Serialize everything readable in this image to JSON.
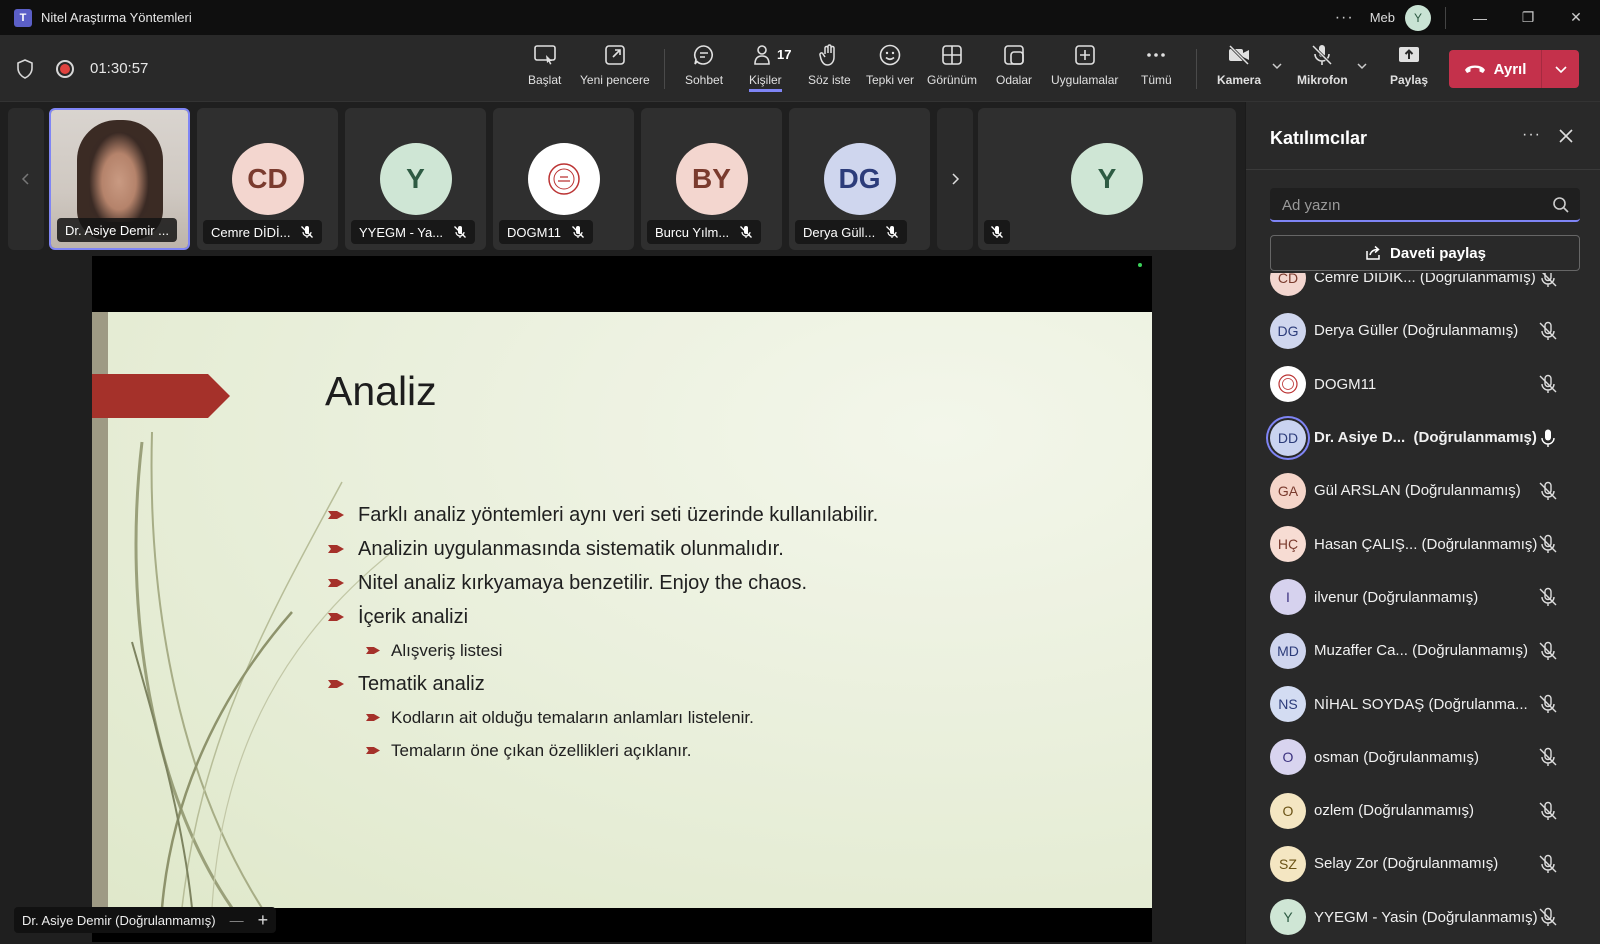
{
  "window": {
    "title": "Nitel Araştırma Yöntemleri",
    "logo_glyph": "T",
    "more": "···",
    "org": "Meb",
    "user_avatar": "Y",
    "min": "—",
    "restore": "❐",
    "close": "✕"
  },
  "meeting": {
    "timer": "01:30:57"
  },
  "toolbar": {
    "start": "Başlat",
    "new_window": "Yeni pencere",
    "chat": "Sohbet",
    "people": "Kişiler",
    "people_count": "17",
    "raise_hand": "Söz iste",
    "react": "Tepki ver",
    "view": "Görünüm",
    "rooms": "Odalar",
    "apps": "Uygulamalar",
    "more": "Tümü",
    "camera": "Kamera",
    "mic": "Mikrofon",
    "share": "Paylaş",
    "leave": "Ayrıl"
  },
  "tiles": [
    {
      "name": "Dr. Asiye Demir ..."
    },
    {
      "name": "Cemre DİDİ...",
      "initials": "CD"
    },
    {
      "name": "YYEGM - Ya...",
      "initials": "Y"
    },
    {
      "name": "DOGM11"
    },
    {
      "name": "Burcu Yılm...",
      "initials": "BY"
    },
    {
      "name": "Derya Güll...",
      "initials": "DG"
    },
    {
      "initials": "Y"
    }
  ],
  "slide": {
    "title": "Analiz",
    "bullets": [
      "Farklı analiz yöntemleri aynı veri seti üzerinde kullanılabilir.",
      "Analizin uygulanmasında sistematik olunmalıdır.",
      "Nitel analiz kırkyamaya benzetilir. Enjoy the chaos.",
      "İçerik analizi",
      "Alışveriş listesi",
      "Tematik analiz",
      "Kodların ait olduğu temaların anlamları listelenir.",
      "Temaların öne çıkan özellikleri açıklanır."
    ]
  },
  "speaker_label": "Dr. Asiye Demir (Doğrulanmamış)",
  "speaker_controls": {
    "minus": "—",
    "plus": "+"
  },
  "panel": {
    "title": "Katılımcılar",
    "more": "···",
    "search_placeholder": "Ad yazın",
    "share_invite": "Daveti paylaş",
    "participants": [
      {
        "initials": "CD",
        "name": "Cemre DİDİK... (Doğrulanmamış)",
        "color": "#f3d6cf",
        "fg": "#7a3b2e"
      },
      {
        "initials": "DG",
        "name": "Derya Güller (Doğrulanmamış)",
        "color": "#cfd6ee",
        "fg": "#2c3c7a"
      },
      {
        "initials": "",
        "name": "DOGM11",
        "color": "#ffffff",
        "fg": "#b33"
      },
      {
        "initials": "DD",
        "name": "Dr. Asiye D...",
        "suffix": "(Doğrulanmamış)",
        "color": "#c9d3f0",
        "fg": "#2c3c7a"
      },
      {
        "initials": "GA",
        "name": "Gül ARSLAN (Doğrulanmamış)",
        "color": "#f5d5c9",
        "fg": "#7a3b2e"
      },
      {
        "initials": "HÇ",
        "name": "Hasan ÇALIŞ... (Doğrulanmamış)",
        "color": "#f7dcd3",
        "fg": "#7a3b2e"
      },
      {
        "initials": "I",
        "name": "ilvenur (Doğrulanmamış)",
        "color": "#d6d2ee",
        "fg": "#3d3380"
      },
      {
        "initials": "MD",
        "name": "Muzaffer Ca... (Doğrulanmamış)",
        "color": "#cfd5ee",
        "fg": "#2c3c7a"
      },
      {
        "initials": "NS",
        "name": "NİHAL SOYDAŞ (Doğrulanma...",
        "color": "#d3dcf2",
        "fg": "#2c3c7a"
      },
      {
        "initials": "O",
        "name": "osman (Doğrulanmamış)",
        "color": "#d8d4ef",
        "fg": "#3d3380"
      },
      {
        "initials": "O",
        "name": "ozlem (Doğrulanmamış)",
        "color": "#f4e6c2",
        "fg": "#6b5316"
      },
      {
        "initials": "SZ",
        "name": "Selay Zor (Doğrulanmamış)",
        "color": "#f4e6c2",
        "fg": "#6b5316"
      },
      {
        "initials": "Y",
        "name": "YYEGM - Yasin (Doğrulanmamış)",
        "color": "#cfe6d5",
        "fg": "#2e5b43"
      }
    ]
  },
  "colors": {
    "accent": "#7f85f5",
    "leave": "#c4314b",
    "slide_ribbon": "#a5312a",
    "slide_bullet": "#a5312a"
  }
}
